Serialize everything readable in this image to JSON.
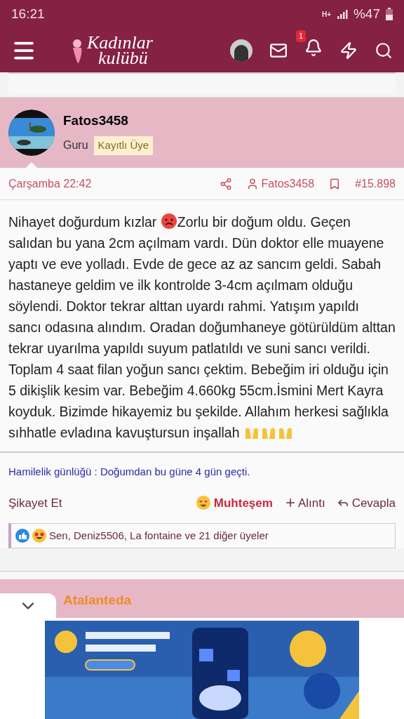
{
  "status_bar": {
    "time": "16:21",
    "network": "H+",
    "battery": "%47"
  },
  "header": {
    "logo_line_1": "Kadınlar",
    "logo_line_2": "kulübü",
    "notification_count": "1"
  },
  "post": {
    "author": "Fatos3458",
    "rank": "Guru",
    "badge": "Kayıtlı Üye",
    "date": "Çarşamba 22:42",
    "author_link": "Fatos3458",
    "post_number": "#15.898",
    "body": [
      {
        "kind": "text",
        "text": "Nihayet doğurdum kızlar "
      },
      {
        "kind": "emoji"
      },
      {
        "kind": "text",
        "text": "Zorlu bir doğum oldu. Geçen salıdan bu yana 2cm açılmam vardı. Dün doktor elle muayene yaptı ve eve yolladı. Evde de gece az az sancım geldi. Sabah hastaneye geldim ve ilk kontrolde 3-4cm açılmam olduğu söylendi. Doktor tekrar alttan uyardı rahmi. Yatışım yapıldı sancı odasına alındım. Oradan doğumhaneye götürüldüm alttan tekrar uyarılma yapıldı suyum patlatıldı ve suni sancı verildi. Toplam 4 saat filan yoğun sancı çektim. Bebeğim iri olduğu için 5 dikişlik kesim var. Bebeğim 4.660kg 55cm.İsmini Mert Kayra koyduk. Bizimde hikayemiz bu şekilde. Allahım herkesi sağlıkla sıhhatle evladına kavuştursun inşallah "
      },
      {
        "kind": "hands"
      }
    ],
    "signature": "Hamilelik günlüğü : Doğumdan bu güne 4 gün geçti.",
    "report": "Şikayet Et",
    "reaction": "Muhteşem",
    "quote": "Alıntı",
    "reply": "Cevapla",
    "reactions_summary": "Sen, Deniz5506, La fontaine ve 21 diğer üyeler"
  },
  "next_post": {
    "author": "Atalanteda"
  }
}
